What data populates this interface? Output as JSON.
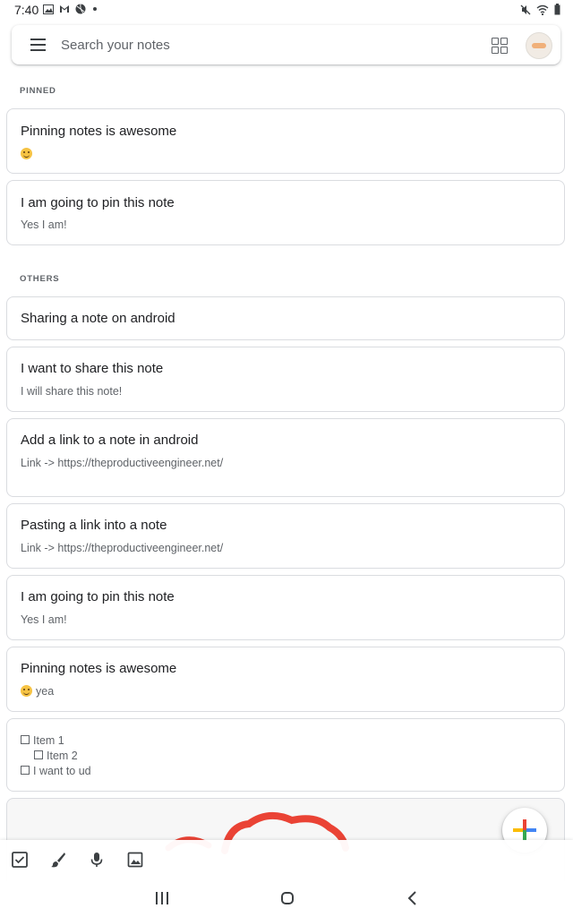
{
  "status_bar": {
    "time": "7:40",
    "left_icons": [
      "image-icon",
      "gmail-icon",
      "sports-icon",
      "dot-icon"
    ],
    "right_icons": [
      "mute-icon",
      "wifi-icon",
      "battery-icon"
    ]
  },
  "search": {
    "placeholder": "Search your notes"
  },
  "sections": {
    "pinned": "PINNED",
    "others": "OTHERS"
  },
  "pinned_notes": [
    {
      "title": "Pinning notes is awesome",
      "body": "",
      "emoji": "smiley"
    },
    {
      "title": "I am going to pin this note",
      "body": "Yes I am!"
    }
  ],
  "other_notes": [
    {
      "title": "Sharing a note on android",
      "body": ""
    },
    {
      "title": "I want to share this note",
      "body": "I will share this note!"
    },
    {
      "title": "Add a link to a note in android",
      "body": "Link -> https://theproductiveengineer.net/"
    },
    {
      "title": "Pasting a link into a note",
      "body": "Link -> https://theproductiveengineer.net/"
    },
    {
      "title": "I am going to pin this note",
      "body": "Yes I am!"
    },
    {
      "title": "Pinning notes is awesome",
      "body": "yea",
      "emoji": "smiley"
    }
  ],
  "checklist_note": {
    "items": [
      {
        "label": "Item 1",
        "indent": 0,
        "checked": false
      },
      {
        "label": "Item 2",
        "indent": 1,
        "checked": false
      },
      {
        "label": "I want to ud",
        "indent": 0,
        "checked": false
      }
    ]
  },
  "bottom_toolbar": {
    "icons": [
      "checkbox-icon",
      "brush-icon",
      "mic-icon",
      "image-icon"
    ]
  },
  "fab": {
    "icon": "plus-icon",
    "colors": [
      "#ea4335",
      "#4285f4",
      "#fbbc05",
      "#34a853"
    ]
  },
  "drawing": {
    "stroke_color": "#ea4335"
  },
  "nav": {
    "icons": [
      "recent-apps-icon",
      "home-icon",
      "back-icon"
    ]
  }
}
